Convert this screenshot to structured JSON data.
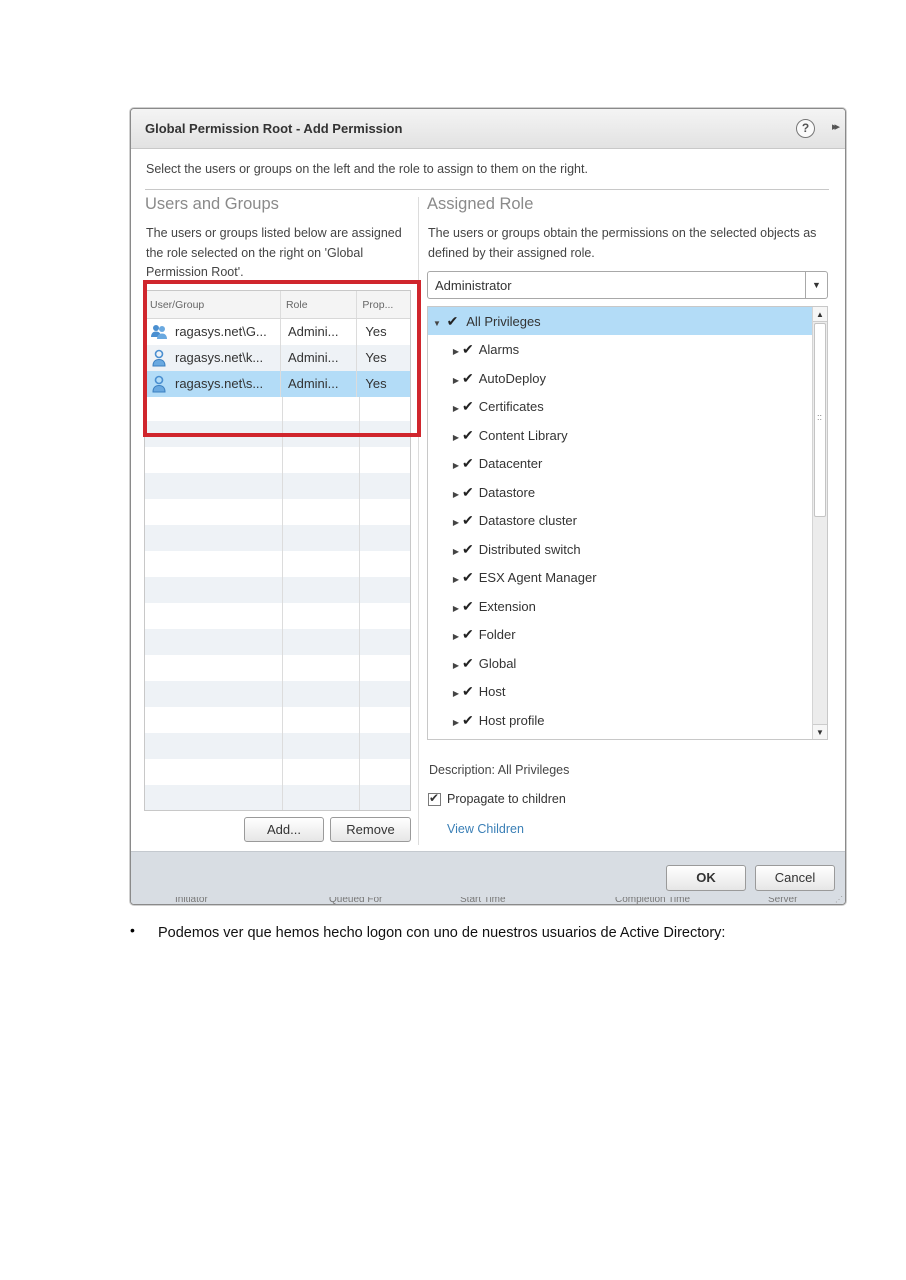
{
  "dialog": {
    "title": "Global Permission Root - Add Permission",
    "help_glyph": "?",
    "expand_glyph": "▸▸",
    "instructions": "Select the users or groups on the left and the role to assign to them on the right."
  },
  "users": {
    "heading": "Users and Groups",
    "description": "The users or groups listed below are assigned the role selected on the right on 'Global Permission Root'.",
    "columns": [
      "User/Group",
      "Role",
      "Prop..."
    ],
    "rows": [
      {
        "icon": "group-icon",
        "name": "ragasys.net\\G...",
        "role": "Admini...",
        "propagate": "Yes"
      },
      {
        "icon": "user-icon",
        "name": "ragasys.net\\k...",
        "role": "Admini...",
        "propagate": "Yes"
      },
      {
        "icon": "user-icon",
        "name": "ragasys.net\\s...",
        "role": "Admini...",
        "propagate": "Yes",
        "selected": true
      }
    ],
    "add_label": "Add...",
    "remove_label": "Remove"
  },
  "role": {
    "heading": "Assigned Role",
    "description": "The users or groups obtain the permissions on the selected objects as defined by their assigned role.",
    "selected": "Administrator",
    "privileges_root": "All Privileges",
    "privileges": [
      "Alarms",
      "AutoDeploy",
      "Certificates",
      "Content Library",
      "Datacenter",
      "Datastore",
      "Datastore cluster",
      "Distributed switch",
      "ESX Agent Manager",
      "Extension",
      "Folder",
      "Global",
      "Host",
      "Host profile"
    ],
    "description_label": "Description:",
    "description_value": "All Privileges",
    "propagate_label": "Propagate to children",
    "propagate_checked": true,
    "view_children": "View Children"
  },
  "footer": {
    "ok_label": "OK",
    "cancel_label": "Cancel",
    "background_headers": [
      "Initiator",
      "Queued For",
      "Start Time",
      "Completion Time",
      "Server"
    ]
  },
  "colors": {
    "selection": "#b3dcf7",
    "highlight_box": "#d0262d",
    "link": "#3a7fb6"
  },
  "document": {
    "bullet_glyph": "•",
    "bullet_text": "Podemos ver que hemos hecho logon con uno de nuestros usuarios de Active Directory:"
  }
}
